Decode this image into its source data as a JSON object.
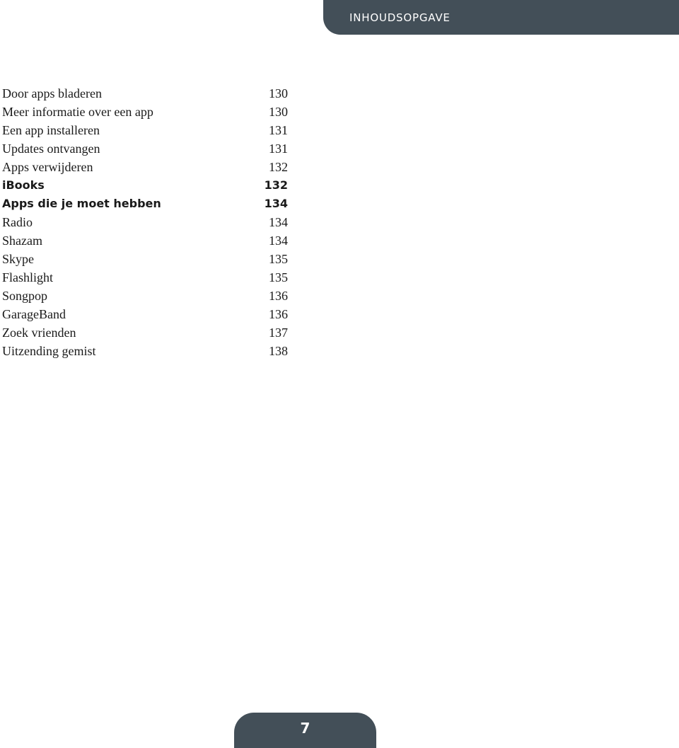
{
  "header": {
    "title": "INHOUDSOPGAVE"
  },
  "toc": [
    {
      "title": "Door apps bladeren",
      "page": "130",
      "bold": false
    },
    {
      "title": "Meer informatie over een app",
      "page": "130",
      "bold": false
    },
    {
      "title": "Een app installeren",
      "page": "131",
      "bold": false
    },
    {
      "title": "Updates ontvangen",
      "page": "131",
      "bold": false
    },
    {
      "title": "Apps verwijderen",
      "page": "132",
      "bold": false
    },
    {
      "title": "iBooks",
      "page": "132",
      "bold": true
    },
    {
      "title": "Apps die je moet hebben",
      "page": "134",
      "bold": true
    },
    {
      "title": "Radio",
      "page": "134",
      "bold": false
    },
    {
      "title": "Shazam",
      "page": "134",
      "bold": false
    },
    {
      "title": "Skype",
      "page": "135",
      "bold": false
    },
    {
      "title": "Flashlight",
      "page": "135",
      "bold": false
    },
    {
      "title": "Songpop",
      "page": "136",
      "bold": false
    },
    {
      "title": "GarageBand",
      "page": "136",
      "bold": false
    },
    {
      "title": "Zoek vrienden",
      "page": "137",
      "bold": false
    },
    {
      "title": "Uitzending gemist",
      "page": "138",
      "bold": false
    }
  ],
  "footer": {
    "page_number": "7"
  }
}
